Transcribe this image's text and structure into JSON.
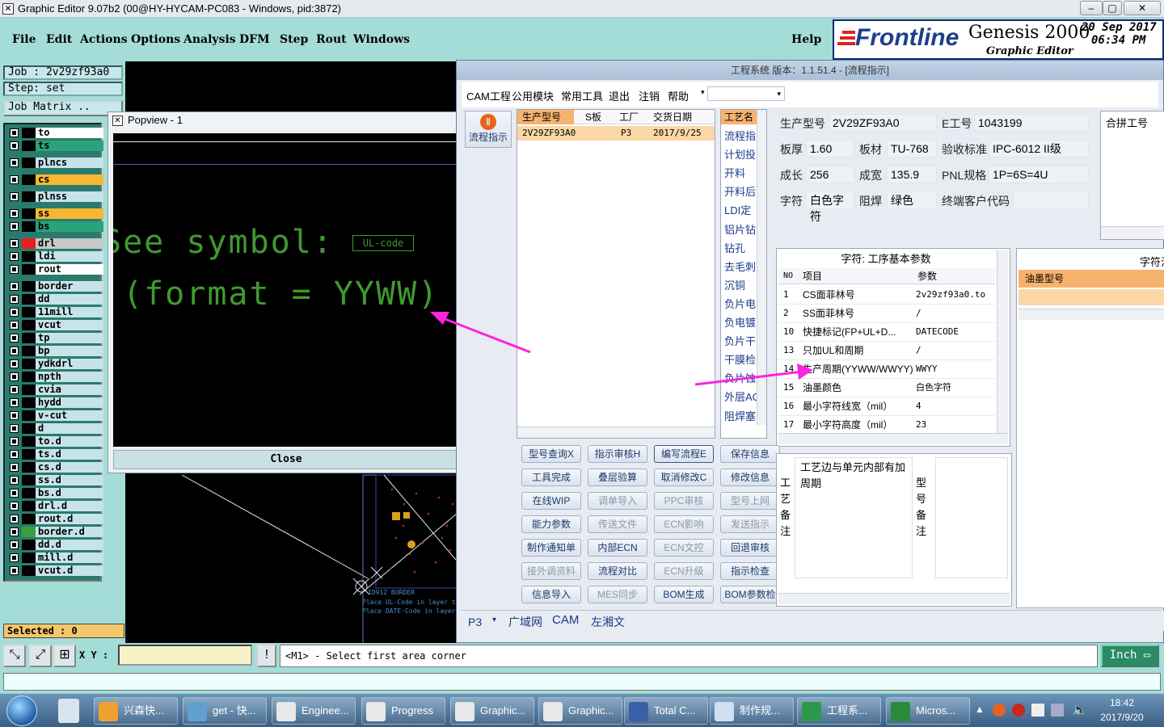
{
  "genesis": {
    "title": "Graphic Editor 9.07b2 (00@HY-HYCAM-PC083 - Windows, pid:3872)",
    "menu": [
      "File",
      "Edit",
      "Actions",
      "Options",
      "Analysis",
      "DFM",
      "Step",
      "Rout",
      "Windows"
    ],
    "help": "Help",
    "brand": "Frontline",
    "product": "Genesis 2000",
    "subtitle": "Graphic Editor",
    "date": "20 Sep 2017",
    "time": "06:34 PM",
    "job": "Job : 2v29zf93a0",
    "step": "Step: set",
    "job_matrix": "Job Matrix ..",
    "layers": [
      {
        "name": "to",
        "color": "#ffffff"
      },
      {
        "name": "ts",
        "color": "#2aa37a"
      },
      {
        "name": "plncs",
        "color": "#c7e3ea"
      },
      {
        "name": "cs",
        "color": "#f7b733"
      },
      {
        "name": "plnss",
        "color": "#c7e3ea"
      },
      {
        "name": "ss",
        "color": "#f7b733"
      },
      {
        "name": "bs",
        "color": "#2aa37a"
      },
      {
        "name": "drl",
        "color": "#c7c7c7"
      },
      {
        "name": "ldi",
        "color": "#c7e3ea"
      },
      {
        "name": "rout",
        "color": "#ffffff"
      },
      {
        "name": "border",
        "color": "#c7e3ea"
      },
      {
        "name": "dd",
        "color": "#c7e3ea"
      },
      {
        "name": "11mill",
        "color": "#c7e3ea"
      },
      {
        "name": "vcut",
        "color": "#c7e3ea"
      },
      {
        "name": "tp",
        "color": "#c7e3ea"
      },
      {
        "name": "bp",
        "color": "#c7e3ea"
      },
      {
        "name": "ydkdrl",
        "color": "#c7e3ea"
      },
      {
        "name": "npth",
        "color": "#c7e3ea"
      },
      {
        "name": "cvia",
        "color": "#c7e3ea"
      },
      {
        "name": "hydd",
        "color": "#c7e3ea"
      },
      {
        "name": "v-cut",
        "color": "#c7e3ea"
      },
      {
        "name": "d",
        "color": "#c7e3ea"
      },
      {
        "name": "to.d",
        "color": "#c7e3ea"
      },
      {
        "name": "ts.d",
        "color": "#c7e3ea"
      },
      {
        "name": "cs.d",
        "color": "#c7e3ea"
      },
      {
        "name": "ss.d",
        "color": "#c7e3ea"
      },
      {
        "name": "bs.d",
        "color": "#c7e3ea"
      },
      {
        "name": "drl.d",
        "color": "#c7e3ea"
      },
      {
        "name": "rout.d",
        "color": "#c7e3ea"
      },
      {
        "name": "border.d",
        "color": "#c7e3ea"
      },
      {
        "name": "dd.d",
        "color": "#c7e3ea"
      },
      {
        "name": "mill.d",
        "color": "#c7e3ea"
      },
      {
        "name": "vcut.d",
        "color": "#c7e3ea"
      }
    ],
    "selected": "Selected : 0",
    "popview_title": "Popview - 1",
    "popview_line1": "See symbol:",
    "popview_symbol": "UL-code",
    "popview_line2": "(format = YYWW)",
    "popview_close": "Close",
    "canvas_text1": "ID912  BORDER",
    "canvas_text2": "Place UL-Code in layer ts",
    "canvas_text3": "Place DATE-Code in layer",
    "xy_label": "X Y :",
    "message": "<M1> - Select first area corner",
    "units": "Inch"
  },
  "eng": {
    "title": "工程系统   版本：1.1.51.4 - [流程指示]",
    "menu": [
      "CAM工程",
      "公用模块",
      "常用工具",
      "退出",
      "注销",
      "帮助"
    ],
    "side_button": "流程指示",
    "grid_headers": [
      "生产型号",
      "S板",
      "工厂",
      "交货日期"
    ],
    "grid_row": [
      "2V29ZF93A0",
      "",
      "P3",
      "2017/9/25"
    ],
    "process_header": "工艺名",
    "process_items": [
      "流程指",
      "计划投",
      "开料",
      "开料后",
      "LDI定",
      "铝片钻",
      "钻孔",
      "去毛刺",
      "沉铜",
      "负片电",
      "负电镀",
      "负片干",
      "干膜检",
      "负片蚀",
      "外层AO",
      "阻焊塞"
    ],
    "fields": {
      "model_label": "生产型号",
      "model": "2V29ZF93A0",
      "eno_label": "E工号",
      "eno": "1043199",
      "thick_label": "板厚",
      "thick": "1.60",
      "material_label": "板材",
      "material": "TU-768",
      "accept_label": "验收标准",
      "accept": "IPC-6012 II级",
      "len_label": "成长",
      "len": "256",
      "wid_label": "成宽",
      "wid": "135.9",
      "pnl_label": "PNL规格",
      "pnl": "1P=6S=4U",
      "char_label": "字符",
      "char": "白色字符",
      "mask_label": "阻焊",
      "mask": "绿色",
      "cust_label": "终端客户代码",
      "cust": ""
    },
    "merge_label": "合拼工号",
    "param_title": "字符: 工序基本参数",
    "param_headers": [
      "NO",
      "项目",
      "参数"
    ],
    "param_rows": [
      {
        "no": "1",
        "item": "CS面菲林号",
        "val": "2v29zf93a0.to"
      },
      {
        "no": "2",
        "item": "SS面菲林号",
        "val": "/"
      },
      {
        "no": "10",
        "item": "快捷标记(FP+UL+D...",
        "val": "DATECODE"
      },
      {
        "no": "13",
        "item": "只加UL和周期",
        "val": "/"
      },
      {
        "no": "14",
        "item": "生产周期(YYWW/WWYY)",
        "val": "WWYY"
      },
      {
        "no": "15",
        "item": "油墨颜色",
        "val": "白色字符"
      },
      {
        "no": "16",
        "item": "最小字符线宽（mil）",
        "val": "4"
      },
      {
        "no": "17",
        "item": "最小字符高度（mil）",
        "val": "23"
      }
    ],
    "right_title": "字符油",
    "right_header": "油墨型号",
    "buttons": [
      {
        "label": "型号查询X",
        "dis": false
      },
      {
        "label": "指示审核H",
        "dis": false
      },
      {
        "label": "编写流程E",
        "dis": false
      },
      {
        "label": "保存信息",
        "dis": false
      },
      {
        "label": "工具完成",
        "dis": false
      },
      {
        "label": "叠层验算",
        "dis": false
      },
      {
        "label": "取消修改C",
        "dis": false
      },
      {
        "label": "修改信息",
        "dis": false
      },
      {
        "label": "在线WIP",
        "dis": false
      },
      {
        "label": "调单导入",
        "dis": true
      },
      {
        "label": "PPC审核",
        "dis": true
      },
      {
        "label": "型号上网",
        "dis": true
      },
      {
        "label": "能力参数",
        "dis": false
      },
      {
        "label": "传送文件",
        "dis": true
      },
      {
        "label": "ECN影响",
        "dis": true
      },
      {
        "label": "发送指示",
        "dis": true
      },
      {
        "label": "制作通知单",
        "dis": false
      },
      {
        "label": "内部ECN",
        "dis": false
      },
      {
        "label": "ECN文控",
        "dis": true
      },
      {
        "label": "回退审核",
        "dis": false
      },
      {
        "label": "接外调资料",
        "dis": true
      },
      {
        "label": "流程对比",
        "dis": false
      },
      {
        "label": "ECN升级",
        "dis": true
      },
      {
        "label": "指示检查",
        "dis": false
      },
      {
        "label": "信息导入",
        "dis": false
      },
      {
        "label": "MES同步",
        "dis": true
      },
      {
        "label": "BOM生成",
        "dis": false
      },
      {
        "label": "BOM参数检",
        "dis": false
      }
    ],
    "remark_label": "工艺备注",
    "remark_text": "工艺边与单元内部有加周期",
    "model_remark_label": "型号备注",
    "bottom_tabs": [
      "P3",
      "广域网",
      "CAM",
      "左湘文"
    ]
  },
  "taskbar": {
    "items": [
      "兴森快...",
      "get - 快...",
      "Enginee...",
      "Progress",
      "Graphic...",
      "Graphic...",
      "Total C...",
      "制作规...",
      "工程系...",
      "Micros..."
    ],
    "time": "18:42",
    "date": "2017/9/20"
  }
}
